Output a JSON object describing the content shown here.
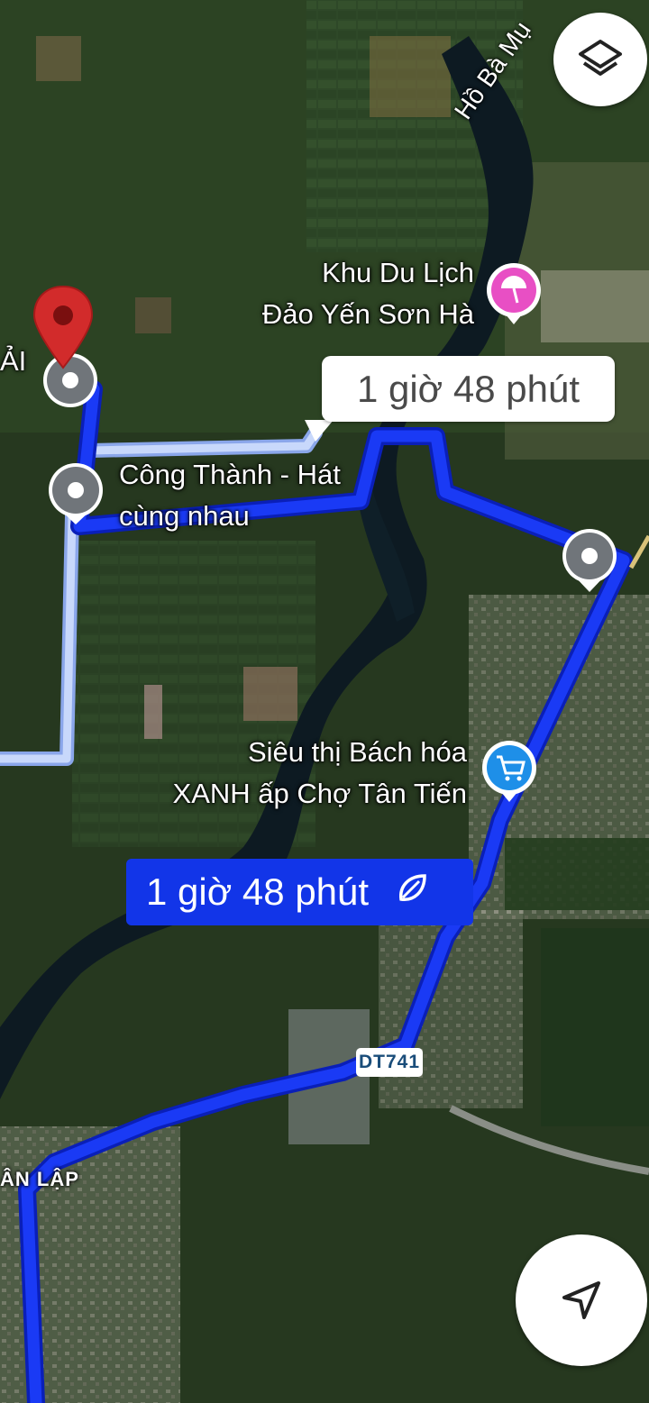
{
  "map": {
    "type": "satellite",
    "route_color": "#1a3af5",
    "alt_route_color": "#a9c2f5"
  },
  "labels": {
    "lake": "Hồ Bà Mụ",
    "resort_line1": "Khu Du Lịch",
    "resort_line2": "Đảo Yến Sơn Hà",
    "karaoke_line1": "Công Thành - Hát",
    "karaoke_line2": "cùng nhau",
    "store_line1": "Siêu thị Bách hóa",
    "store_line2": "XANH ấp Chợ Tân Tiến",
    "cut_left_place": "ẢI",
    "area_bottom_left": "ÂN LẬP"
  },
  "route": {
    "alt_duration": "1 giờ 48 phút",
    "main_duration": "1 giờ 48 phút",
    "eco_icon": "leaf-icon"
  },
  "road": {
    "badge": "DT741"
  },
  "controls": {
    "layers_icon": "layers-icon",
    "locate_icon": "navigation-arrow-icon"
  },
  "poi_icons": {
    "resort": {
      "icon": "beach-umbrella-icon",
      "color": "#e84fc4"
    },
    "store": {
      "icon": "shopping-cart-icon",
      "color": "#1e8fe8"
    },
    "destination_pin_color": "#d22b2b"
  }
}
